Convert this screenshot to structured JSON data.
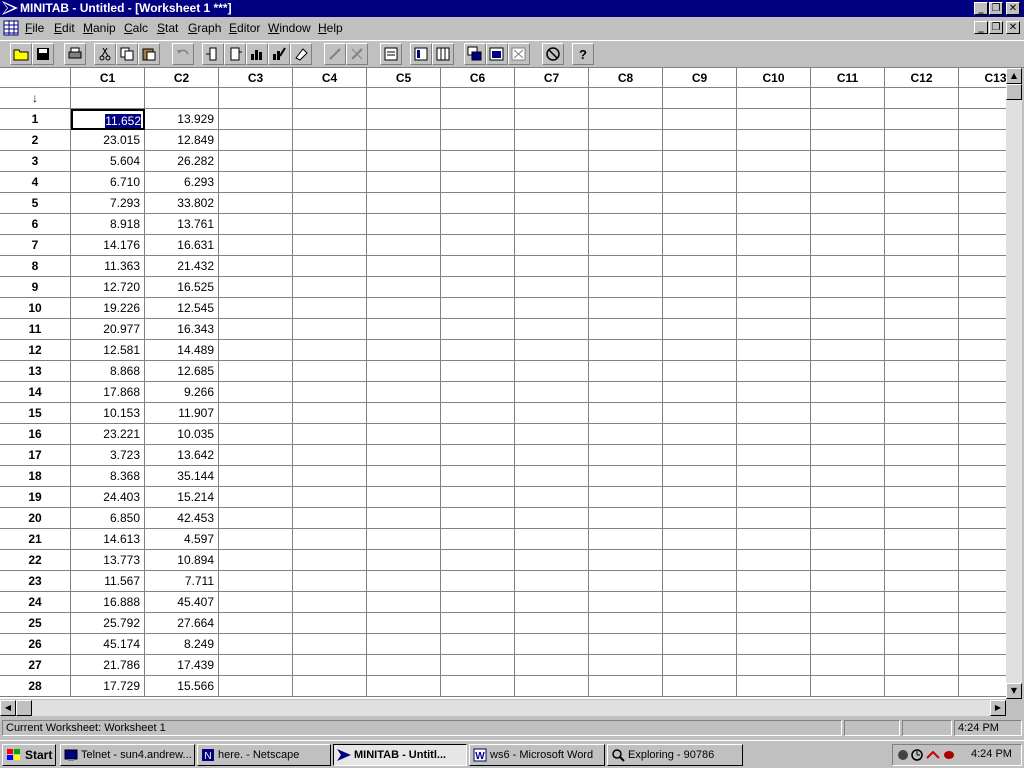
{
  "window": {
    "title": "MINITAB - Untitled - [Worksheet 1 ***]",
    "minimize": "_",
    "restore": "❐",
    "close": "✕"
  },
  "menu": [
    {
      "label": "File",
      "ul": "F",
      "rest": "ile"
    },
    {
      "label": "Edit",
      "ul": "E",
      "rest": "dit"
    },
    {
      "label": "Manip",
      "ul": "M",
      "rest": "anip"
    },
    {
      "label": "Calc",
      "ul": "C",
      "rest": "alc"
    },
    {
      "label": "Stat",
      "ul": "S",
      "rest": "tat"
    },
    {
      "label": "Graph",
      "ul": "G",
      "rest": "raph"
    },
    {
      "label": "Editor",
      "ul": "E",
      "rest": "ditor"
    },
    {
      "label": "Window",
      "ul": "W",
      "rest": "indow"
    },
    {
      "label": "Help",
      "ul": "H",
      "rest": "elp"
    }
  ],
  "toolbar_icons": [
    "open-icon",
    "save-icon",
    "print-icon",
    "cut-icon",
    "copy-icon",
    "paste-icon",
    "undo-icon",
    "insert-rows-icon",
    "insert-columns-icon",
    "graph-icon",
    "edit-graph-icon",
    "erase-icon",
    "brush-icon",
    "brush2-icon",
    "session-icon",
    "info-icon",
    "data-window-icon",
    "window-cascade-icon",
    "window-tile-icon",
    "window-close-icon",
    "stop-icon",
    "help-icon"
  ],
  "worksheet": {
    "columns": [
      "C1",
      "C2",
      "C3",
      "C4",
      "C5",
      "C6",
      "C7",
      "C8",
      "C9",
      "C10",
      "C11",
      "C12",
      "C13"
    ],
    "data_direction_arrow": "↓",
    "rows": [
      {
        "n": "1",
        "c1": "11.652",
        "c2": "13.929"
      },
      {
        "n": "2",
        "c1": "23.015",
        "c2": "12.849"
      },
      {
        "n": "3",
        "c1": "5.604",
        "c2": "26.282"
      },
      {
        "n": "4",
        "c1": "6.710",
        "c2": "6.293"
      },
      {
        "n": "5",
        "c1": "7.293",
        "c2": "33.802"
      },
      {
        "n": "6",
        "c1": "8.918",
        "c2": "13.761"
      },
      {
        "n": "7",
        "c1": "14.176",
        "c2": "16.631"
      },
      {
        "n": "8",
        "c1": "11.363",
        "c2": "21.432"
      },
      {
        "n": "9",
        "c1": "12.720",
        "c2": "16.525"
      },
      {
        "n": "10",
        "c1": "19.226",
        "c2": "12.545"
      },
      {
        "n": "11",
        "c1": "20.977",
        "c2": "16.343"
      },
      {
        "n": "12",
        "c1": "12.581",
        "c2": "14.489"
      },
      {
        "n": "13",
        "c1": "8.868",
        "c2": "12.685"
      },
      {
        "n": "14",
        "c1": "17.868",
        "c2": "9.266"
      },
      {
        "n": "15",
        "c1": "10.153",
        "c2": "11.907"
      },
      {
        "n": "16",
        "c1": "23.221",
        "c2": "10.035"
      },
      {
        "n": "17",
        "c1": "3.723",
        "c2": "13.642"
      },
      {
        "n": "18",
        "c1": "8.368",
        "c2": "35.144"
      },
      {
        "n": "19",
        "c1": "24.403",
        "c2": "15.214"
      },
      {
        "n": "20",
        "c1": "6.850",
        "c2": "42.453"
      },
      {
        "n": "21",
        "c1": "14.613",
        "c2": "4.597"
      },
      {
        "n": "22",
        "c1": "13.773",
        "c2": "10.894"
      },
      {
        "n": "23",
        "c1": "11.567",
        "c2": "7.711"
      },
      {
        "n": "24",
        "c1": "16.888",
        "c2": "45.407"
      },
      {
        "n": "25",
        "c1": "25.792",
        "c2": "27.664"
      },
      {
        "n": "26",
        "c1": "45.174",
        "c2": "8.249"
      },
      {
        "n": "27",
        "c1": "21.786",
        "c2": "17.439"
      },
      {
        "n": "28",
        "c1": "17.729",
        "c2": "15.566"
      }
    ]
  },
  "status": {
    "text": "Current Worksheet: Worksheet 1",
    "time": "4:24 PM"
  },
  "taskbar": {
    "start": "Start",
    "tasks": [
      {
        "label": "Telnet - sun4.andrew...",
        "icon": "telnet-icon"
      },
      {
        "label": "here. - Netscape",
        "icon": "netscape-icon"
      },
      {
        "label": "MINITAB - Untitl...",
        "icon": "minitab-icon",
        "active": true
      },
      {
        "label": "ws6 - Microsoft Word",
        "icon": "word-icon"
      },
      {
        "label": "Exploring - 90786",
        "icon": "explorer-icon"
      }
    ],
    "clock": "4:24 PM"
  }
}
